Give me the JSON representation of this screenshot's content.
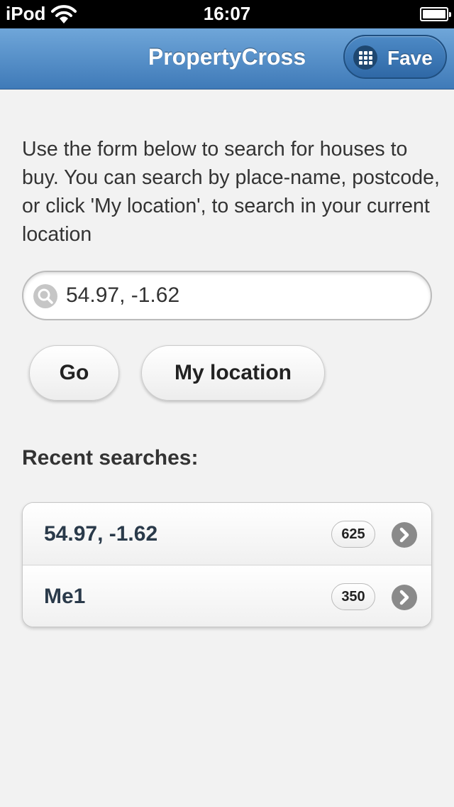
{
  "status_bar": {
    "carrier": "iPod",
    "time": "16:07",
    "wifi_icon": "wifi-icon",
    "battery_icon": "battery-icon"
  },
  "header": {
    "title": "PropertyCross",
    "fave_button": {
      "label": "Fave",
      "icon": "grid-icon"
    },
    "accent_color": "#4a86c5"
  },
  "intro_text": "Use the form below to search for houses to buy. You can search by place-name, postcode, or click 'My location', to search in your current location",
  "search": {
    "value": "54.97, -1.62",
    "icon": "search-icon"
  },
  "buttons": {
    "go_label": "Go",
    "my_location_label": "My location"
  },
  "recent": {
    "title": "Recent searches:",
    "items": [
      {
        "place": "54.97, -1.62",
        "count": "625",
        "icon": "chevron-right-icon"
      },
      {
        "place": "Me1",
        "count": "350",
        "icon": "chevron-right-icon"
      }
    ]
  }
}
